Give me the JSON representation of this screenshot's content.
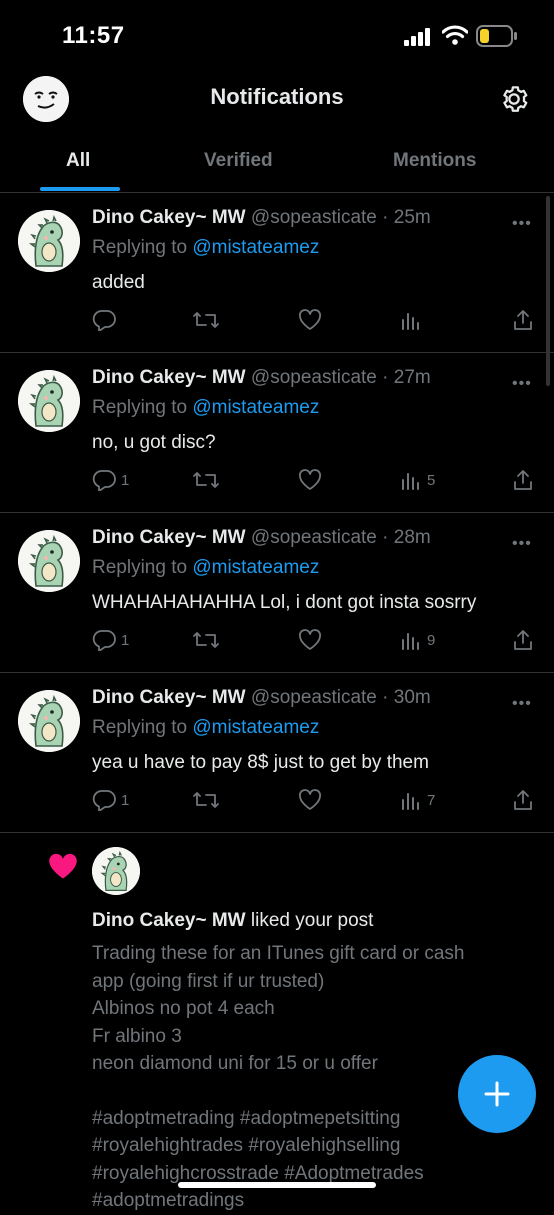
{
  "status": {
    "time": "11:57"
  },
  "header": {
    "title": "Notifications"
  },
  "tabs": [
    {
      "label": "All"
    },
    {
      "label": "Verified"
    },
    {
      "label": "Mentions"
    }
  ],
  "notifications": [
    {
      "name": "Dino Cakey~ MW",
      "handle": "@sopeasticate",
      "time": "25m",
      "replying_prefix": "Replying to",
      "replying_to": "@mistateamez",
      "text": "added",
      "replies": "",
      "views": ""
    },
    {
      "name": "Dino Cakey~ MW",
      "handle": "@sopeasticate",
      "time": "27m",
      "replying_prefix": "Replying to",
      "replying_to": "@mistateamez",
      "text": "no, u got disc?",
      "replies": "1",
      "views": "5"
    },
    {
      "name": "Dino Cakey~ MW",
      "handle": "@sopeasticate",
      "time": "28m",
      "replying_prefix": "Replying to",
      "replying_to": "@mistateamez",
      "text": "WHAHAHAHAHHA Lol, i dont got insta sosrry",
      "replies": "1",
      "views": "9"
    },
    {
      "name": "Dino Cakey~ MW",
      "handle": "@sopeasticate",
      "time": "30m",
      "replying_prefix": "Replying to",
      "replying_to": "@mistateamez",
      "text": "yea u have to pay 8$ just to get by them",
      "replies": "1",
      "views": "7"
    }
  ],
  "like_notification": {
    "name": "Dino Cakey~ MW",
    "action": "liked your post",
    "post_lines": [
      "Trading these for an ITunes gift card or cash",
      "app (going first if ur trusted)",
      "Albinos no pot 4 each",
      "Fr albino 3",
      "neon diamond uni for 15 or u offer",
      "",
      "#adoptmetrading #adoptmepetsitting",
      "#royalehightrades #royalehighselling",
      "#royalehighcrosstrade #Adoptmetrades",
      "#adoptmetradings"
    ]
  },
  "colors": {
    "accent": "#1d9bf0",
    "like": "#f91880",
    "muted": "#71767b",
    "background": "#000000"
  },
  "icons": [
    "reply-icon",
    "retweet-icon",
    "like-icon",
    "views-icon",
    "share-icon",
    "gear-icon",
    "compose-icon",
    "heart-icon"
  ]
}
